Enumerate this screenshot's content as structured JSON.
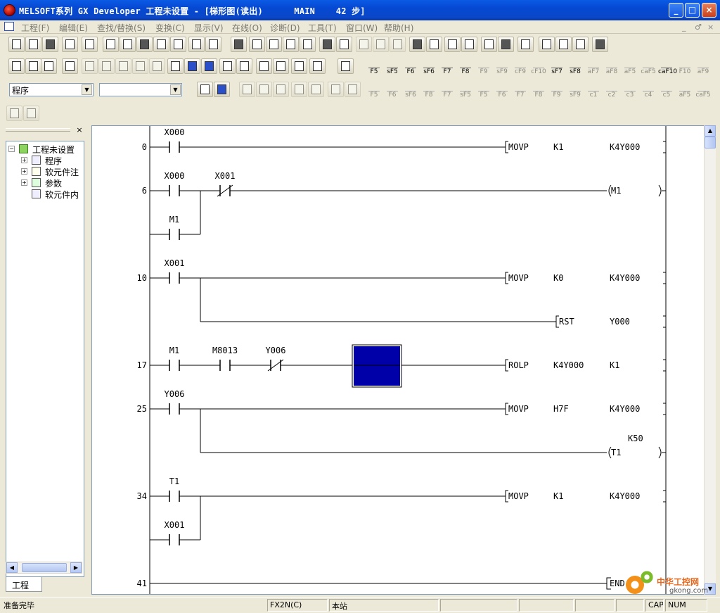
{
  "window": {
    "title": "MELSOFT系列 GX Developer 工程未设置 - [梯形图(读出)      MAIN    42 步]",
    "minimize_label": "_",
    "maximize_label": "□",
    "close_label": "×"
  },
  "menu": {
    "items": [
      "工程(F)",
      "编辑(E)",
      "查找/替换(S)",
      "变换(C)",
      "显示(V)",
      "在线(O)",
      "诊断(D)",
      "工具(T)",
      "窗口(W)",
      "帮助(H)"
    ],
    "mdi_controls": [
      "_",
      "♂",
      "×"
    ]
  },
  "toolbar": {
    "program_combo": "程序",
    "second_combo": "",
    "fkeys_row1": [
      "F5",
      "sF5",
      "F6",
      "sF6",
      "F7",
      "F8",
      "F9",
      "sF9",
      "cF9",
      "cF10",
      "sF7",
      "sF8",
      "aF7",
      "aF8",
      "aF5",
      "caF5",
      "caF10",
      "F10",
      "aF9"
    ],
    "fkeys_row2": [
      "F5",
      "F6",
      "sF6",
      "F8",
      "F7",
      "sF5",
      "F5",
      "F6",
      "F7",
      "F8",
      "F9",
      "sF9",
      "c1",
      "c2",
      "c3",
      "c4",
      "c5",
      "aF5",
      "caF5"
    ]
  },
  "project_tree": {
    "tab_label": "工程",
    "close_label": "×",
    "root": "工程未设置",
    "items": [
      {
        "label": "程序",
        "expander": "+"
      },
      {
        "label": "软元件注",
        "expander": "+"
      },
      {
        "label": "参数",
        "expander": "+"
      },
      {
        "label": "软元件内",
        "expander": ""
      }
    ]
  },
  "ladder": {
    "rungs": [
      {
        "step": "0",
        "contacts": [
          {
            "label": "X000",
            "type": "NO"
          }
        ],
        "instruction": {
          "op": "MOVP",
          "src": "K1",
          "dst": "K4Y000"
        }
      },
      {
        "step": "6",
        "contacts": [
          {
            "label": "X000",
            "type": "NO"
          },
          {
            "label": "X001",
            "type": "NC"
          }
        ],
        "branch": [
          {
            "label": "M1",
            "type": "NO"
          }
        ],
        "coil": "M1"
      },
      {
        "step": "10",
        "contacts": [
          {
            "label": "X001",
            "type": "NO"
          }
        ],
        "instruction": {
          "op": "MOVP",
          "src": "K0",
          "dst": "K4Y000"
        },
        "second_output": {
          "op": "RST",
          "operand": "Y000"
        }
      },
      {
        "step": "17",
        "contacts": [
          {
            "label": "M1",
            "type": "NO"
          },
          {
            "label": "M8013",
            "type": "NO"
          },
          {
            "label": "Y006",
            "type": "NC"
          }
        ],
        "instruction": {
          "op": "ROLP",
          "src": "K4Y000",
          "dst": "K1"
        }
      },
      {
        "step": "25",
        "contacts": [
          {
            "label": "Y006",
            "type": "NO"
          }
        ],
        "instruction": {
          "op": "MOVP",
          "src": "H7F",
          "dst": "K4Y000"
        },
        "timer": {
          "coil": "T1",
          "preset": "K50"
        }
      },
      {
        "step": "34",
        "contacts": [
          {
            "label": "T1",
            "type": "NO"
          }
        ],
        "branch": [
          {
            "label": "X001",
            "type": "NO"
          }
        ],
        "instruction": {
          "op": "MOVP",
          "src": "K1",
          "dst": "K4Y000"
        }
      },
      {
        "step": "41",
        "end_label": "END"
      }
    ]
  },
  "statusbar": {
    "message": "准备完毕",
    "plc_type": "FX2N(C)",
    "station": "本站",
    "caps": "CAP",
    "num": "NUM"
  },
  "watermark": {
    "cn": "中华工控网",
    "en": "gkong.com"
  },
  "colors": {
    "titlebar": "#0a5be5",
    "cursor": "#0000a8"
  }
}
